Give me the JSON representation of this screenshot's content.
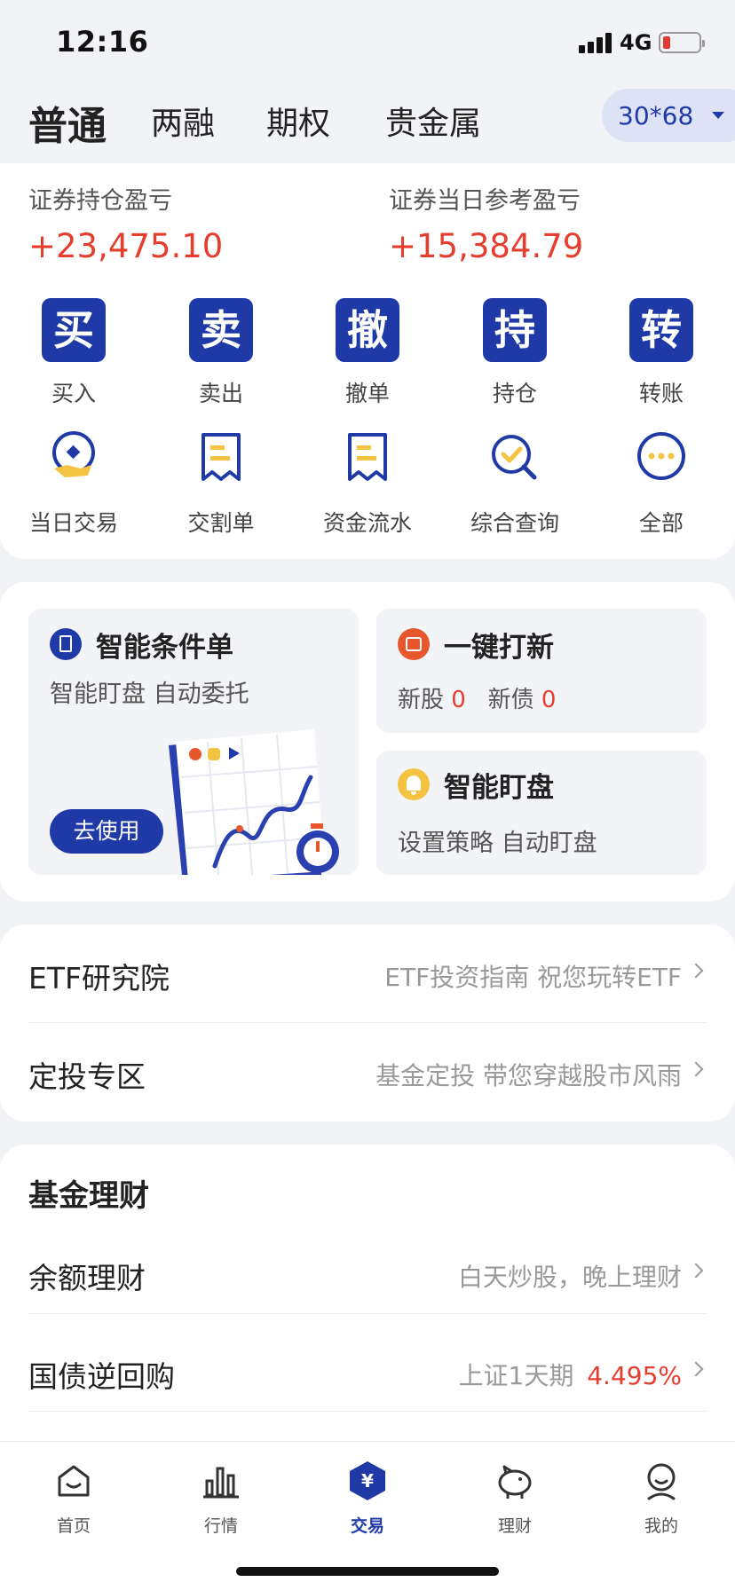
{
  "status_bar": {
    "time": "12:16",
    "network": "4G"
  },
  "top_tabs": [
    {
      "label": "普通",
      "active": true
    },
    {
      "label": "两融",
      "active": false
    },
    {
      "label": "期权",
      "active": false
    },
    {
      "label": "贵金属",
      "active": false
    }
  ],
  "account": {
    "label": "30*68"
  },
  "pnl": {
    "holding_label": "证券持仓盈亏",
    "holding_value": "+23,475.10",
    "today_label": "证券当日参考盈亏",
    "today_value": "+15,384.79"
  },
  "quick_actions": [
    {
      "glyph": "买",
      "label": "买入"
    },
    {
      "glyph": "卖",
      "label": "卖出"
    },
    {
      "glyph": "撤",
      "label": "撤单"
    },
    {
      "glyph": "持",
      "label": "持仓"
    },
    {
      "glyph": "转",
      "label": "转账"
    }
  ],
  "tools": [
    {
      "label": "当日交易",
      "icon": "daily-trade-icon"
    },
    {
      "label": "交割单",
      "icon": "delivery-slip-icon"
    },
    {
      "label": "资金流水",
      "icon": "cash-flow-icon"
    },
    {
      "label": "综合查询",
      "icon": "query-icon"
    },
    {
      "label": "全部",
      "icon": "more-icon"
    }
  ],
  "features": {
    "smart_order": {
      "title": "智能条件单",
      "subtitle": "智能盯盘 自动委托",
      "button": "去使用"
    },
    "ipo": {
      "title": "一键打新",
      "stock_label": "新股",
      "stock_count": "0",
      "bond_label": "新债",
      "bond_count": "0"
    },
    "monitor": {
      "title": "智能盯盘",
      "subtitle": "设置策略 自动盯盘"
    }
  },
  "links": [
    {
      "title": "ETF研究院",
      "desc": "ETF投资指南 祝您玩转ETF"
    },
    {
      "title": "定投专区",
      "desc": "基金定投 带您穿越股市风雨"
    }
  ],
  "fund": {
    "title": "基金理财",
    "rows": [
      {
        "title": "余额理财",
        "desc": "白天炒股，晚上理财"
      },
      {
        "title": "国债逆回购",
        "desc": "上证1天期",
        "rate": "4.495%"
      }
    ]
  },
  "tab_bar": [
    {
      "label": "首页",
      "icon": "home-icon"
    },
    {
      "label": "行情",
      "icon": "market-icon"
    },
    {
      "label": "交易",
      "icon": "trade-icon",
      "active": true
    },
    {
      "label": "理财",
      "icon": "wealth-icon"
    },
    {
      "label": "我的",
      "icon": "profile-icon"
    }
  ],
  "colors": {
    "brand": "#1f3aa6",
    "gain": "#e53e2f",
    "accent_yellow": "#f5c342",
    "accent_orange": "#e8572c"
  }
}
